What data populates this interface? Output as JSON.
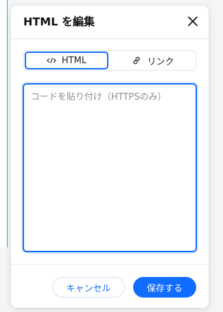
{
  "dialog": {
    "title": "HTML を編集",
    "close_icon": "close-icon"
  },
  "tabs": [
    {
      "label": "HTML",
      "icon": "code-icon",
      "selected": true
    },
    {
      "label": "リンク",
      "icon": "link-icon",
      "selected": false
    }
  ],
  "editor": {
    "value": "",
    "placeholder": "コードを貼り付け（HTTPSのみ）"
  },
  "footer": {
    "cancel_label": "キャンセル",
    "save_label": "保存する"
  },
  "colors": {
    "accent": "#116dff",
    "title": "#111111",
    "placeholder": "#8a8f98"
  }
}
